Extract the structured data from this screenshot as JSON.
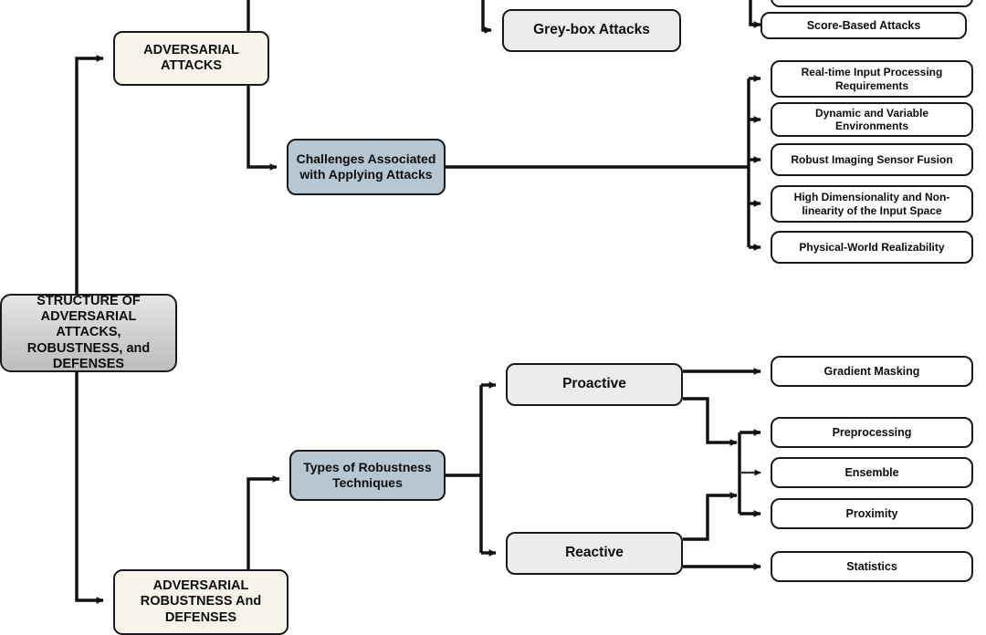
{
  "diagram": {
    "title": "STRUCTURE OF ADVERSARIAL ATTACKS, ROBUSTNESS, and DEFENSES",
    "colors": {
      "root_fill": "#d2d2d2",
      "cream_fill": "#f7f4ec",
      "blue_fill": "#b6c6d2",
      "grey_fill": "#ececec",
      "white_fill": "#ffffff",
      "stroke": "#1a1a1a",
      "text": "#0d0d0d"
    },
    "nodes": {
      "root": {
        "label": "STRUCTURE OF ADVERSARIAL ATTACKS, ROBUSTNESS, and DEFENSES"
      },
      "adversarial_attacks": {
        "label": "ADVERSARIAL ATTACKS"
      },
      "adversarial_robustness": {
        "label": "ADVERSARIAL ROBUSTNESS And DEFENSES"
      },
      "challenges": {
        "label": "Challenges Associated with Applying Attacks"
      },
      "types_robustness": {
        "label": "Types of Robustness Techniques"
      },
      "grey_box": {
        "label": "Grey-box Attacks"
      },
      "score_based": {
        "label": "Score-Based Attacks"
      },
      "proactive": {
        "label": "Proactive"
      },
      "reactive": {
        "label": "Reactive"
      }
    },
    "challenge_items": [
      {
        "label": "Real-time Input Processing Requirements"
      },
      {
        "label": "Dynamic and Variable Environments"
      },
      {
        "label": "Robust Imaging Sensor Fusion"
      },
      {
        "label": "High Dimensionality and Non-linearity of the Input Space"
      },
      {
        "label": "Physical-World Realizability"
      }
    ],
    "robustness_items": [
      {
        "label": "Gradient Masking"
      },
      {
        "label": "Preprocessing"
      },
      {
        "label": "Ensemble"
      },
      {
        "label": "Proximity"
      },
      {
        "label": "Statistics"
      }
    ]
  }
}
